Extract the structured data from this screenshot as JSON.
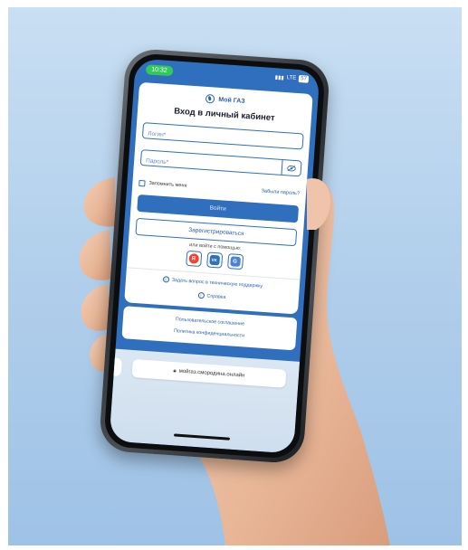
{
  "status": {
    "time": "10:32",
    "network": "LTE",
    "battery": "57"
  },
  "app": {
    "logo_text": "Мой ГАЗ",
    "title": "Вход в личный кабинет"
  },
  "login_form": {
    "login_placeholder": "Логин*",
    "password_placeholder": "Пароль*",
    "remember_label": "Запомнить меня",
    "forgot_label": "Забыли пароль?",
    "submit_label": "Войти",
    "register_label": "Зарегистрироваться",
    "alt_login_label": "или войти с помощью:"
  },
  "social_logins": [
    {
      "name": "yandex",
      "glyph": "Я",
      "color": "#f5442d"
    },
    {
      "name": "vk",
      "glyph": "VK",
      "color": "#2f6fbe"
    },
    {
      "name": "gosuslugi",
      "glyph": "G",
      "color": "#4a83d4"
    }
  ],
  "help": {
    "support_label": "Задать вопрос в техническую поддержку",
    "reference_label": "Справка"
  },
  "legal": {
    "agreement_label": "Пользовательское соглашение",
    "privacy_label": "Политика конфиденциальности"
  },
  "browser": {
    "url": "мойгаз.смородина.онлайн"
  },
  "colors": {
    "brand": "#2f6fbe",
    "background": "#b3d0ec"
  }
}
